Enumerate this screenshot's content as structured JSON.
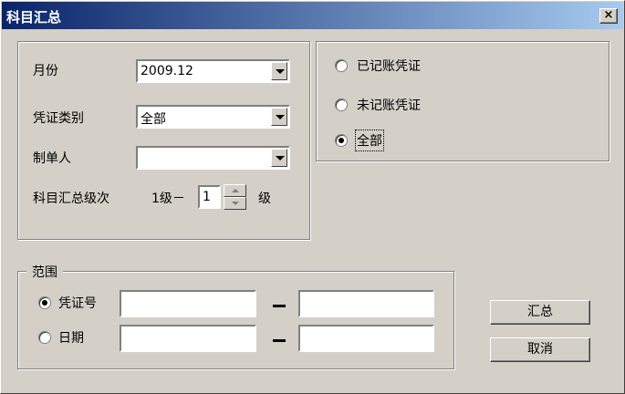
{
  "window": {
    "title": "科目汇总",
    "close_label": "×"
  },
  "fields": {
    "month": {
      "label": "月份",
      "value": "2009.12"
    },
    "voucher_type": {
      "label": "凭证类别",
      "value": "全部"
    },
    "preparer": {
      "label": "制单人",
      "value": ""
    },
    "level": {
      "label": "科目汇总级次",
      "prefix": "1级－",
      "value": "1",
      "suffix": "级"
    }
  },
  "posting": {
    "options": [
      {
        "label": "已记账凭证",
        "checked": false
      },
      {
        "label": "未记账凭证",
        "checked": false
      },
      {
        "label": "全部",
        "checked": true
      }
    ]
  },
  "range": {
    "title": "范围",
    "voucher_no": {
      "label": "凭证号",
      "checked": true,
      "from": "",
      "to": ""
    },
    "date": {
      "label": "日期",
      "checked": false,
      "from": "",
      "to": ""
    },
    "separator": "－"
  },
  "buttons": {
    "summarize": "汇总",
    "cancel": "取消"
  }
}
